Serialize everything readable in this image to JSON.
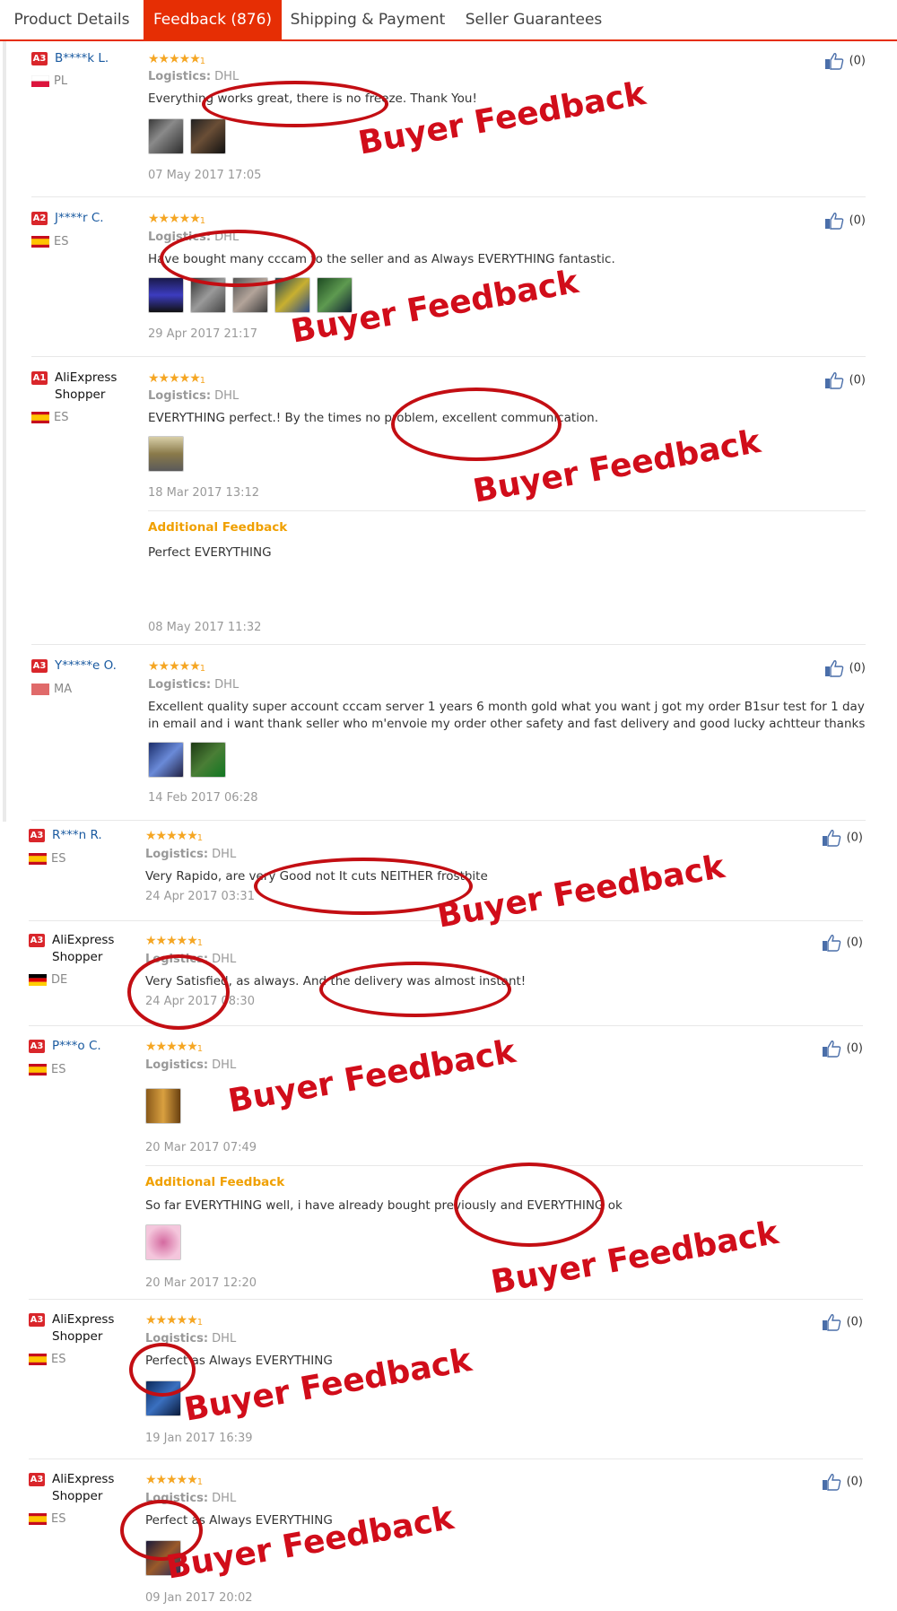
{
  "tabs": [
    {
      "label": "Product Details"
    },
    {
      "label": "Feedback (876)"
    },
    {
      "label": "Shipping & Payment"
    },
    {
      "label": "Seller Guarantees"
    }
  ],
  "common": {
    "logistics_label": "Logistics:",
    "logistics_value": "DHL",
    "like_count": "(0)",
    "additional_label": "Additional Feedback",
    "stars": "★★★★★",
    "star_suffix": "1",
    "stamp": "Buyer Feedback"
  },
  "feedback": [
    {
      "badge": "A3",
      "name": "B****k L.",
      "country": "PL",
      "text": "Everything works great, there is no freeze. Thank You!",
      "date": "07 May 2017 17:05"
    },
    {
      "badge": "A2",
      "name": "J****r C.",
      "country": "ES",
      "text": "Have bought many cccam to the seller and as Always EVERYTHING fantastic.",
      "date": "29 Apr 2017 21:17"
    },
    {
      "badge": "A1",
      "name": "AliExpress Shopper",
      "country": "ES",
      "text": "EVERYTHING perfect.! By the times no problem, excellent communication.",
      "date": "18 Mar 2017 13:12",
      "additional_text": "Perfect EVERYTHING",
      "additional_date": "08 May 2017 11:32"
    },
    {
      "badge": "A3",
      "name": "Y*****e O.",
      "country": "MA",
      "text": "Excellent quality super account cccam server 1 years 6 month gold what you want j got my order B1sur test for 1 day in email and i want thank seller who m'envoie my order other safety and fast delivery and good lucky achtteur thanks",
      "date": "14 Feb 2017 06:28"
    },
    {
      "badge": "A3",
      "name": "R***n R.",
      "country": "ES",
      "text": "Very Rapido, are very Good not It cuts NEITHER frostbite",
      "date": "24 Apr 2017 03:31"
    },
    {
      "badge": "A3",
      "name": "AliExpress Shopper",
      "country": "DE",
      "text": "Very Satisfied, as always. And the delivery was almost instant!",
      "date": "24 Apr 2017 08:30"
    },
    {
      "badge": "A3",
      "name": "P***o C.",
      "country": "ES",
      "text": "",
      "date": "20 Mar 2017 07:49",
      "additional_text": "So far EVERYTHING well, i have already bought previously and EVERYTHING ok",
      "additional_date": "20 Mar 2017 12:20"
    },
    {
      "badge": "A3",
      "name": "AliExpress Shopper",
      "country": "ES",
      "text": "Perfect as Always EVERYTHING",
      "date": "19 Jan 2017 16:39"
    },
    {
      "badge": "A3",
      "name": "AliExpress Shopper",
      "country": "ES",
      "text": "Perfect as Always EVERYTHING",
      "date": "09 Jan 2017 20:02"
    }
  ]
}
